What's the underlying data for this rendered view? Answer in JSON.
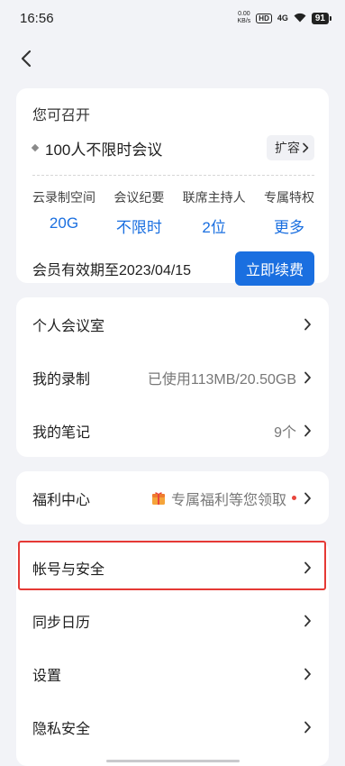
{
  "status_bar": {
    "time": "16:56",
    "net_speed_value": "0.00",
    "net_speed_unit": "KB/s",
    "hd": "HD",
    "signal": "4G",
    "battery": "91"
  },
  "plan": {
    "label": "您可召开",
    "name": "100人不限时会议",
    "expand_label": "扩容",
    "features": [
      {
        "label": "云录制空间",
        "value": "20G"
      },
      {
        "label": "会议纪要",
        "value": "不限时"
      },
      {
        "label": "联席主持人",
        "value": "2位"
      },
      {
        "label": "专属特权",
        "value": "更多"
      }
    ],
    "expiry": "会员有效期至2023/04/15",
    "renew_label": "立即续费"
  },
  "group1": [
    {
      "label": "个人会议室",
      "value": ""
    },
    {
      "label": "我的录制",
      "value": "已使用113MB/20.50GB"
    },
    {
      "label": "我的笔记",
      "value": "9个"
    }
  ],
  "welfare": {
    "label": "福利中心",
    "value": "专属福利等您领取"
  },
  "group2": [
    {
      "label": "帐号与安全"
    },
    {
      "label": "同步日历"
    },
    {
      "label": "设置"
    },
    {
      "label": "隐私安全"
    }
  ],
  "colors": {
    "accent": "#1a6fe0",
    "highlight": "#e53935",
    "background": "#f2f3f7"
  }
}
